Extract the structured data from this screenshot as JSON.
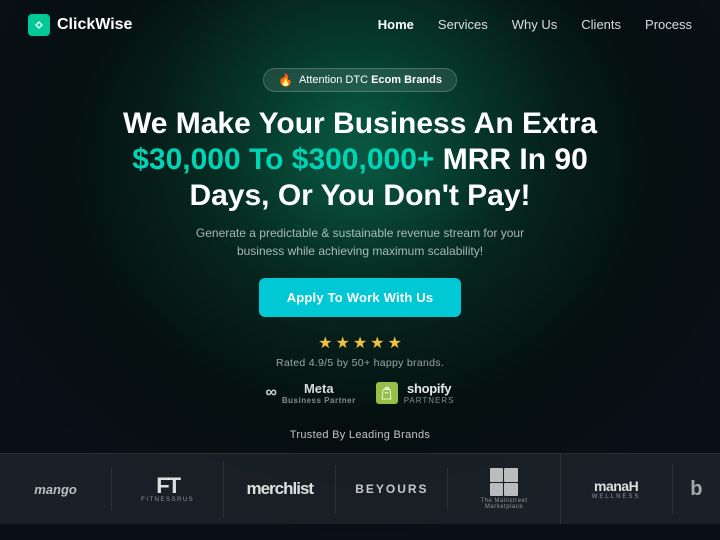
{
  "meta": {
    "title": "ClickWise"
  },
  "nav": {
    "logo_text": "ClickWise",
    "links": [
      {
        "label": "Home",
        "active": true
      },
      {
        "label": "Services",
        "active": false
      },
      {
        "label": "Why Us",
        "active": false
      },
      {
        "label": "Clients",
        "active": false
      },
      {
        "label": "Process",
        "active": false
      }
    ]
  },
  "hero": {
    "badge_text": "Attention DTC",
    "badge_highlight": "Ecom Brands",
    "headline_line1": "We Make Your Business An Extra",
    "headline_highlight": "$30,000 To $300,000+",
    "headline_line2": "MRR In 90",
    "headline_line3": "Days, Or You Don't Pay!",
    "subtext": "Generate a predictable & sustainable revenue stream for your business while achieving maximum scalability!",
    "cta_label": "Apply To Work With Us",
    "stars_count": 5,
    "rating_text": "Rated 4.9/5 by 50+ happy brands.",
    "partners": {
      "meta_label": "Meta",
      "meta_sub": "Business Partner",
      "shopify_label": "shopify",
      "shopify_sub": "partners"
    }
  },
  "trusted": {
    "title": "Trusted By Leading Brands",
    "brands": [
      {
        "id": "mango",
        "label": "mango",
        "style": "italic"
      },
      {
        "id": "ft",
        "label": "FT",
        "style": "bold"
      },
      {
        "id": "merchlist",
        "label": "merchlist",
        "style": "large"
      },
      {
        "id": "beyours",
        "label": "BEYOURS",
        "style": "spaced"
      },
      {
        "id": "meta-marketplace",
        "label": "The Mainstreet Marketplace",
        "style": "grid"
      },
      {
        "id": "manah",
        "label": "manaH",
        "sub": "WELLNESS",
        "style": "manah"
      },
      {
        "id": "more",
        "label": "b",
        "style": "partial"
      }
    ]
  },
  "colors": {
    "accent_cyan": "#00c8d4",
    "accent_teal": "#00d4b4",
    "star_yellow": "#f0c040",
    "background_dark": "#0a1a1a"
  }
}
